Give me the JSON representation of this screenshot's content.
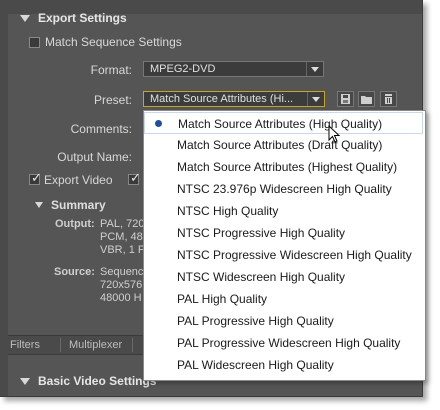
{
  "export_settings": {
    "header": "Export Settings",
    "match_sequence_label": "Match Sequence Settings",
    "format_label": "Format:",
    "format_value": "MPEG2-DVD",
    "preset_label": "Preset:",
    "preset_value": "Match Source Attributes (Hi...",
    "comments_label": "Comments:",
    "output_name_label": "Output Name:",
    "export_video_label": "Export Video",
    "export_video_checked": true,
    "second_export_checked": true
  },
  "summary": {
    "header": "Summary",
    "output_label": "Output:",
    "output_lines": [
      "PAL, 720",
      "PCM, 48",
      "VBR, 1 P"
    ],
    "source_label": "Source:",
    "source_lines": [
      "Sequenc",
      "720x576",
      "48000 H"
    ]
  },
  "tabs": [
    "Filters",
    "Multiplexer"
  ],
  "basic_video_settings": "Basic Video Settings",
  "preset_dropdown": {
    "selected_index": 0,
    "items": [
      "Match Source Attributes (High Quality)",
      "Match Source Attributes (Draft Quality)",
      "Match Source Attributes (Highest Quality)",
      "NTSC 23.976p Widescreen High Quality",
      "NTSC High Quality",
      "NTSC Progressive High Quality",
      "NTSC Progressive Widescreen High Quality",
      "NTSC Widescreen High Quality",
      "PAL High Quality",
      "PAL Progressive High Quality",
      "PAL Progressive Widescreen High Quality",
      "PAL Widescreen High Quality"
    ]
  },
  "colors": {
    "panel_bg": "#555555",
    "focus_border": "#c8a32a",
    "selection_dot": "#1e4f9c"
  },
  "icons": [
    "save-preset-icon",
    "import-preset-icon",
    "delete-preset-icon",
    "mouse-pointer-icon"
  ]
}
